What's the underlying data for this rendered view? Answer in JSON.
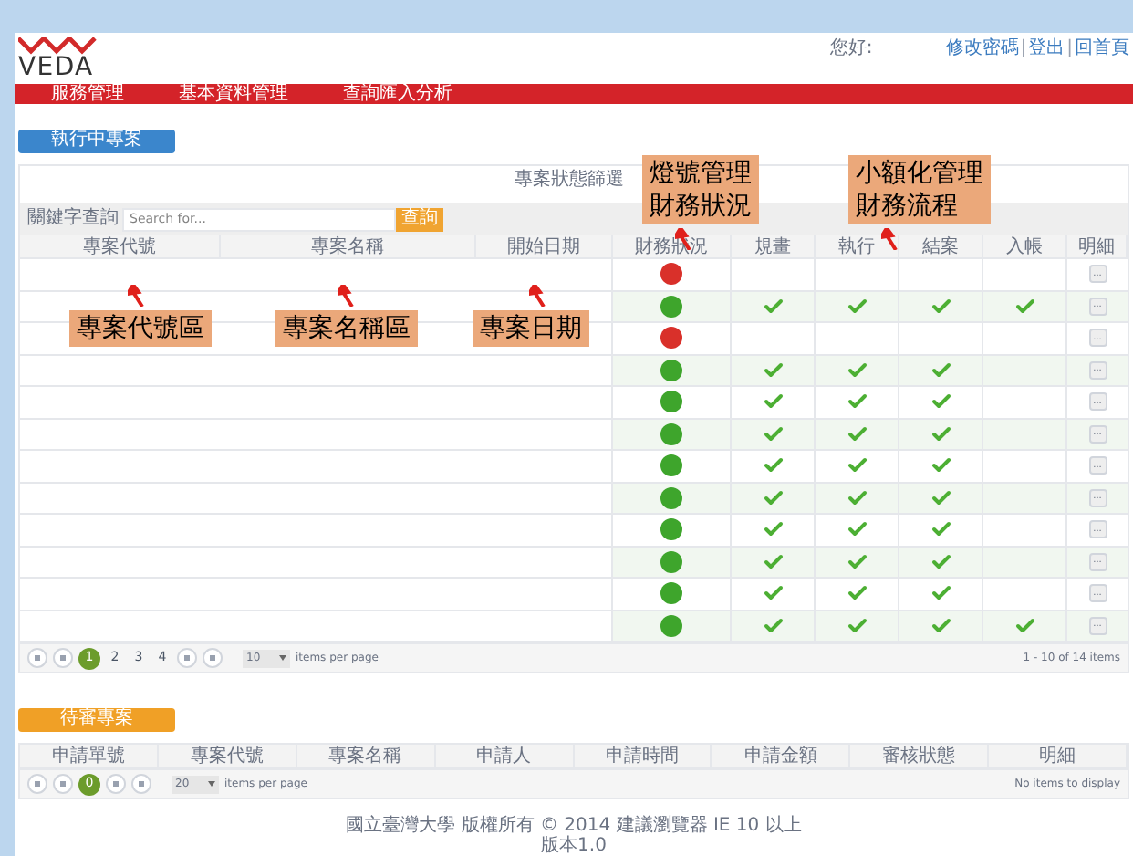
{
  "header": {
    "logo": "VEDA",
    "greeting": "您好:",
    "links": [
      {
        "kind": "link",
        "text": "修改密碼"
      },
      {
        "kind": "separator",
        "text": "|"
      },
      {
        "kind": "link",
        "text": "登出"
      },
      {
        "kind": "separator",
        "text": "|"
      },
      {
        "kind": "link",
        "text": "回首頁"
      }
    ]
  },
  "nav": [
    "服務管理",
    "基本資料管理",
    "查詢匯入分析"
  ],
  "section_button": "執行中專案",
  "filter_label": "專案狀態篩選",
  "search": {
    "label": "關鍵字查詢",
    "placeholder": "Search for...",
    "button": "查詢"
  },
  "table": {
    "columns": [
      "專案代號",
      "專案名稱",
      "開始日期",
      "財務狀況",
      "規畫",
      "執行",
      "結案",
      "入帳",
      "明細"
    ],
    "rows": [
      {
        "color": "#d9302a",
        "done": [
          false,
          false,
          false,
          false
        ],
        "detail": "..."
      },
      {
        "color": "#3ea52c",
        "done": [
          true,
          true,
          true,
          true
        ],
        "detail": "..."
      },
      {
        "color": "#d9302a",
        "done": [
          false,
          false,
          false,
          false
        ],
        "detail": "..."
      },
      {
        "color": "#3ea52c",
        "done": [
          true,
          true,
          true,
          false
        ],
        "detail": "..."
      },
      {
        "color": "#3ea52c",
        "done": [
          true,
          true,
          true,
          false
        ],
        "detail": "..."
      },
      {
        "color": "#3ea52c",
        "done": [
          true,
          true,
          true,
          false
        ],
        "detail": "..."
      },
      {
        "color": "#3ea52c",
        "done": [
          true,
          true,
          true,
          false
        ],
        "detail": "..."
      },
      {
        "color": "#3ea52c",
        "done": [
          true,
          true,
          true,
          false
        ],
        "detail": "..."
      },
      {
        "color": "#3ea52c",
        "done": [
          true,
          true,
          true,
          false
        ],
        "detail": "..."
      },
      {
        "color": "#3ea52c",
        "done": [
          true,
          true,
          true,
          false
        ],
        "detail": "..."
      },
      {
        "color": "#3ea52c",
        "done": [
          true,
          true,
          true,
          false
        ],
        "detail": "..."
      },
      {
        "color": "#3ea52c",
        "done": [
          true,
          true,
          true,
          true
        ],
        "detail": "..."
      }
    ]
  },
  "pager": {
    "pages": [
      {
        "label": "1",
        "selected": true
      },
      {
        "label": "2",
        "selected": false
      },
      {
        "label": "3",
        "selected": false
      },
      {
        "label": "4",
        "selected": false
      }
    ],
    "page_size": "10",
    "per_page": "items per page",
    "summary": "1 - 10 of 14 items"
  },
  "pending_button": "待審專案",
  "pending_table": {
    "columns": [
      "申請單號",
      "專案代號",
      "專案名稱",
      "申請人",
      "申請時間",
      "申請金額",
      "審核狀態",
      "明細"
    ]
  },
  "pending_pager": {
    "pages": [
      {
        "label": "0",
        "selected": true
      }
    ],
    "page_size": "20",
    "per_page": "items per page",
    "summary": "No items to display"
  },
  "footer": [
    "國立臺灣大學 版權所有 © 2014 建議瀏覽器 IE 10 以上",
    "版本1.0"
  ],
  "annotations": [
    [
      "專案代號區"
    ],
    [
      "專案名稱區"
    ],
    [
      "專案日期"
    ],
    [
      "燈號管理",
      "財務狀況"
    ],
    [
      "小額化管理",
      "財務流程"
    ]
  ]
}
